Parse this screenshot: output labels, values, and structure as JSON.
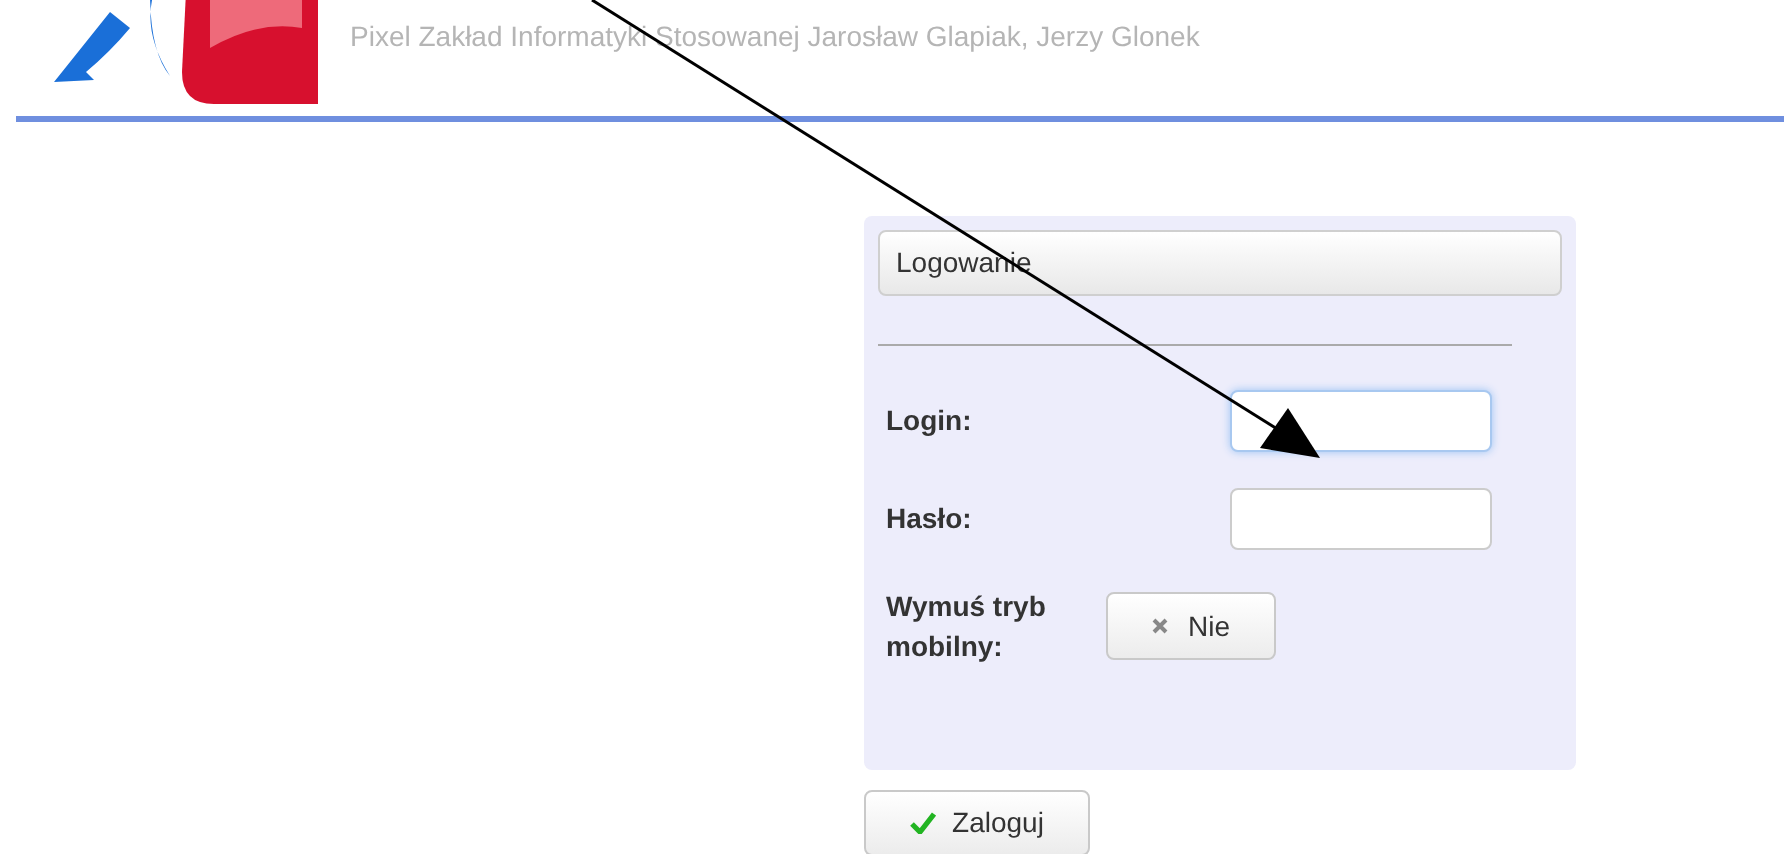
{
  "header": {
    "subtitle": "Pixel Zakład Informatyki Stosowanej Jarosław Glapiak, Jerzy Glonek"
  },
  "panel": {
    "title": "Logowanie",
    "fields": [
      {
        "label": "Login:",
        "focused": true
      },
      {
        "label": "Hasło:",
        "focused": false
      }
    ],
    "mobile": {
      "label": "Wymuś tryb mobilny:",
      "on": false,
      "value": "Nie"
    }
  },
  "submit": "Zaloguj"
}
